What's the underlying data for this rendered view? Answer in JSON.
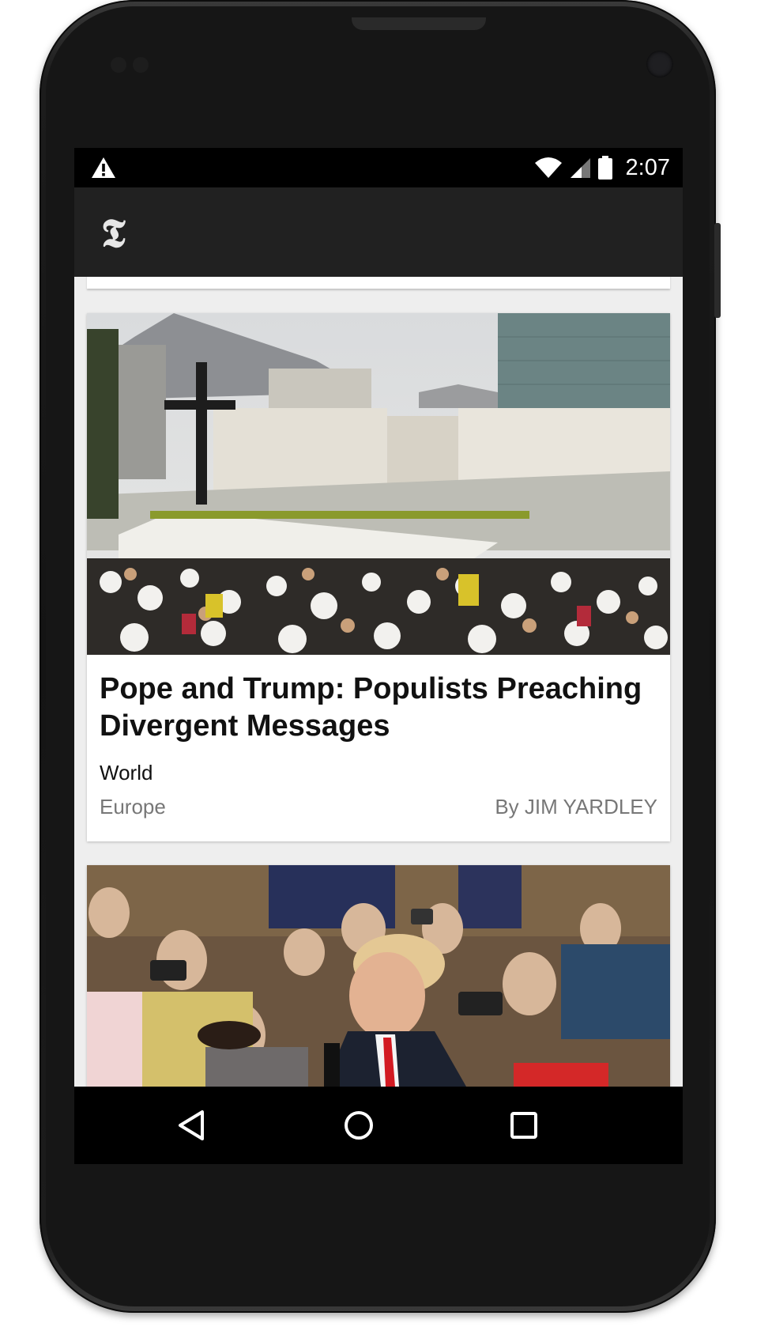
{
  "status_bar": {
    "time": "2:07",
    "icons": [
      "warning-icon",
      "wifi-icon",
      "cell-signal-icon",
      "battery-icon"
    ]
  },
  "app_bar": {
    "logo_text": "𝕿"
  },
  "articles": [
    {
      "headline": "Pope and Trump: Populists Preaching Divergent Messages",
      "section": "World",
      "subsection": "Europe",
      "byline": "By JIM YARDLEY",
      "image": "crowd-at-mass-photo"
    },
    {
      "image": "rally-crowd-photo"
    }
  ],
  "nav_bar": {
    "buttons": [
      "back-icon",
      "home-icon",
      "recents-icon"
    ]
  },
  "colors": {
    "status_bar": "#000000",
    "app_bar": "#212121",
    "background": "#eeeeee",
    "card": "#ffffff"
  }
}
